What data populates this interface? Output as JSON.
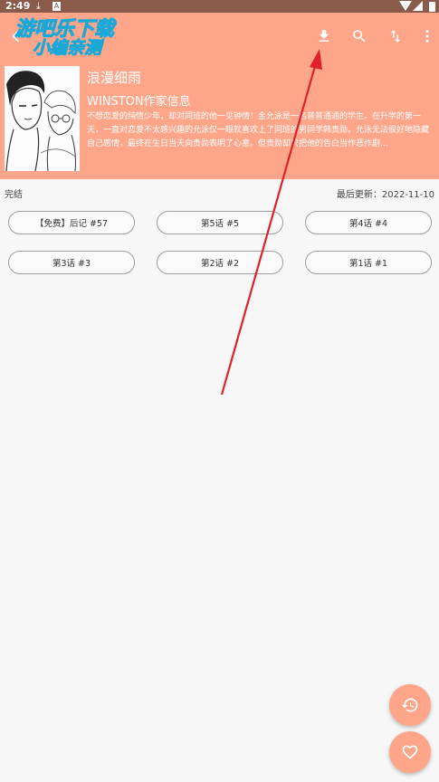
{
  "status_bar": {
    "time": "2:49",
    "download_glyph": "⤓",
    "notif_letter": "A"
  },
  "watermark": {
    "line1": "游吧乐下载",
    "line2": "小编亲测"
  },
  "toolbar": {
    "back_icon": "arrow-back-icon",
    "download_icon": "download-icon",
    "search_icon": "search-icon",
    "sort_icon": "sort-icon",
    "more_icon": "more-vert-icon"
  },
  "comic": {
    "title": "浪漫细雨",
    "author": "WINSTON作家信息",
    "description": "不想恋爱的纯情少年，却对同班的他一见钟情！金允泳是一名普普通通的学生。在升学的第一天，一直对恋爱不太感兴趣的允泳仅一眼就喜欢上了同班的男同学韩贵勋。允泳无法很好地隐藏自己感情，最终在生日当天向贵勋表明了心意。但贵勋却只把他的告白当作恶作剧..."
  },
  "info": {
    "status": "完结",
    "last_update": "最后更新：2022-11-10"
  },
  "chapters": [
    "【免费】后记 #57",
    "第5话 #5",
    "第4话 #4",
    "第3话 #3",
    "第2话 #2",
    "第1话 #1"
  ],
  "fabs": {
    "history_icon": "history-icon",
    "favorite_icon": "heart-icon"
  },
  "colors": {
    "accent": "#ffa68a",
    "status_bar": "#8a5a4a",
    "annotation_arrow": "#e0202a",
    "background": "#f7f7f7"
  }
}
